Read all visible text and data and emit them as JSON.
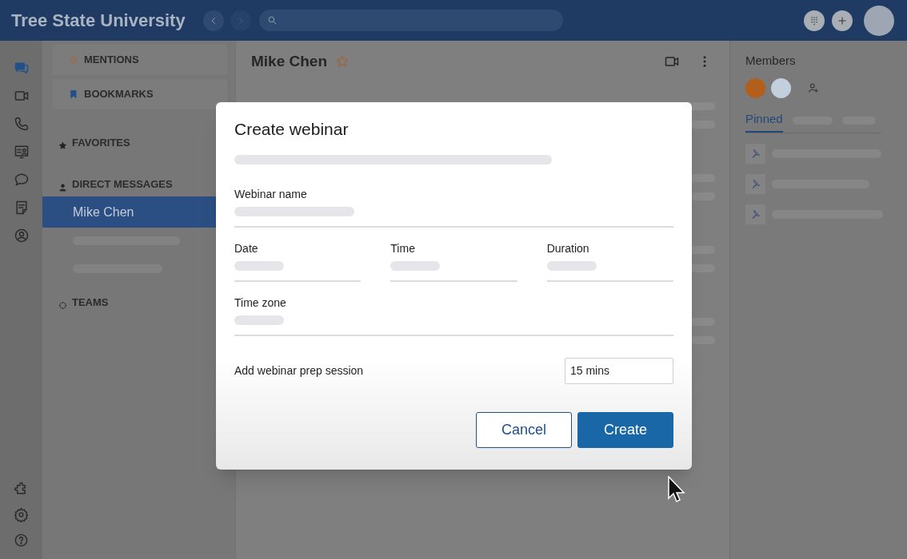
{
  "header": {
    "title": "Tree State University"
  },
  "rail": [
    {
      "kind": "chat",
      "selected": true
    },
    {
      "kind": "video",
      "selected": false
    },
    {
      "kind": "phone",
      "selected": false
    },
    {
      "kind": "contacts",
      "selected": false
    },
    {
      "kind": "bubble",
      "selected": false
    },
    {
      "kind": "notes",
      "selected": false
    },
    {
      "kind": "person",
      "selected": false
    }
  ],
  "rail_bottom": [
    {
      "kind": "puzzle"
    },
    {
      "kind": "settings"
    },
    {
      "kind": "help"
    }
  ],
  "sidebar": {
    "cards": [
      {
        "kind": "mention",
        "label": "MENTIONS"
      },
      {
        "kind": "bookmark",
        "label": "BOOKMARKS"
      }
    ],
    "sections": [
      {
        "kind": "star",
        "label": "FAVORITES"
      },
      {
        "kind": "person",
        "label": "DIRECT MESSAGES",
        "items": [
          {
            "label": "Mike Chen",
            "selected": true
          }
        ]
      },
      {
        "kind": "teams",
        "label": "TEAMS"
      }
    ]
  },
  "chat": {
    "title": "Mike Chen"
  },
  "members": {
    "title": "Members",
    "avatars": [
      {
        "color": "#b35f1c"
      },
      {
        "color": "#c4cfdd"
      }
    ],
    "tabs": [
      {
        "label": "Pinned",
        "selected": true
      }
    ]
  },
  "dialog": {
    "title": "Create webinar",
    "fields": [
      {
        "label": "Webinar name"
      },
      {
        "label": "Date"
      },
      {
        "label": "Time"
      },
      {
        "label": "Duration"
      },
      {
        "label": "Time zone"
      }
    ],
    "prep": {
      "label": "Add webinar prep session",
      "value": "15 mins"
    },
    "buttons": [
      {
        "kind": "secondary",
        "label": "Cancel"
      },
      {
        "kind": "primary",
        "label": "Create"
      }
    ]
  }
}
